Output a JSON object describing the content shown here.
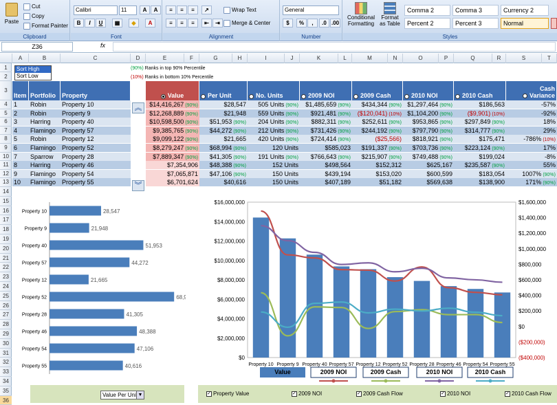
{
  "ribbon": {
    "clipboard": {
      "label": "Clipboard",
      "paste": "Paste",
      "cut": "Cut",
      "copy": "Copy",
      "format_painter": "Format Painter"
    },
    "font": {
      "label": "Font",
      "family": "Calibri",
      "size": "11"
    },
    "alignment": {
      "label": "Alignment",
      "wrap": "Wrap Text",
      "merge": "Merge & Center"
    },
    "number": {
      "label": "Number",
      "format": "General"
    },
    "styles": {
      "label": "Styles",
      "cond": "Conditional",
      "cond2": "Formatting",
      "fmt": "Format",
      "fmt2": "as Table",
      "cells": [
        "Comma 2",
        "Comma 3",
        "Currency 2",
        "Percent 2",
        "Percent 3",
        "Normal"
      ]
    }
  },
  "formula_bar": {
    "cell_ref": "Z36",
    "fx": "fx"
  },
  "columns": [
    "A",
    "B",
    "C",
    "D",
    "E",
    "F",
    "G",
    "H",
    "I",
    "J",
    "K",
    "L",
    "M",
    "N",
    "O",
    "P",
    "Q",
    "R",
    "S",
    "T"
  ],
  "rows": [
    "1",
    "2",
    "3",
    "4",
    "5",
    "6",
    "7",
    "8",
    "9",
    "10",
    "11",
    "12",
    "13",
    "14",
    "15",
    "16",
    "17",
    "18",
    "19",
    "20",
    "21",
    "22",
    "23",
    "24",
    "25",
    "26",
    "27",
    "28",
    "29",
    "30",
    "31",
    "32",
    "33",
    "34",
    "35",
    "36"
  ],
  "sort": {
    "high": "Sort High",
    "low": "Sort Low"
  },
  "legend_notes": {
    "top_tag": "(90%)",
    "top_text": "Ranks in top 90% Percentile",
    "bot_tag": "(10%)",
    "bot_text": "Ranks in bottom 10% Percentile"
  },
  "table": {
    "headers": {
      "item": "Item",
      "portfolio": "Portfolio",
      "property": "Property",
      "value": "Value",
      "per_unit": "Per Unit",
      "units": "No. Units",
      "noi09": "2009 NOI",
      "cash09": "2009 Cash",
      "noi10": "2010 NOI",
      "cash10": "2010 Cash",
      "cashvar1": "Cash",
      "cashvar2": "Variance"
    },
    "rows": [
      {
        "item": "1",
        "portfolio": "Robin",
        "property": "Property 10",
        "value": "$14,416,267",
        "vt": "(90%)",
        "pu": "$28,547",
        "put": "",
        "units": "505 Units",
        "ut": "(90%)",
        "noi09": "$1,485,659",
        "n9t": "(90%)",
        "cash09": "$434,344",
        "c9t": "(90%)",
        "noi10": "$1,297,464",
        "n10t": "(90%)",
        "cash10": "$186,563",
        "c10t": "",
        "cv": "-57%",
        "cvt": ""
      },
      {
        "item": "2",
        "portfolio": "Robin",
        "property": "Property 9",
        "value": "$12,268,889",
        "vt": "(90%)",
        "pu": "$21,948",
        "put": "",
        "units": "559 Units",
        "ut": "(90%)",
        "noi09": "$921,481",
        "n9t": "(90%)",
        "cash09": "($120,041)",
        "c9t": "(10%)",
        "noi10": "$1,104,200",
        "n10t": "(90%)",
        "cash10": "($9,901)",
        "c10t": "(10%)",
        "cv": "-92%",
        "cvt": ""
      },
      {
        "item": "3",
        "portfolio": "Harring",
        "property": "Property 40",
        "value": "$10,598,500",
        "vt": "(90%)",
        "pu": "$51,953",
        "put": "(90%)",
        "units": "204 Units",
        "ut": "(90%)",
        "noi09": "$882,311",
        "n9t": "(90%)",
        "cash09": "$252,611",
        "c9t": "(90%)",
        "noi10": "$953,865",
        "n10t": "(90%)",
        "cash10": "$297,849",
        "c10t": "(90%)",
        "cv": "18%",
        "cvt": ""
      },
      {
        "item": "4",
        "portfolio": "Flamingo",
        "property": "Property 57",
        "value": "$9,385,765",
        "vt": "(90%)",
        "pu": "$44,272",
        "put": "(90%)",
        "units": "212 Units",
        "ut": "(90%)",
        "noi09": "$731,426",
        "n9t": "(90%)",
        "cash09": "$244,192",
        "c9t": "(90%)",
        "noi10": "$797,790",
        "n10t": "(90%)",
        "cash10": "$314,777",
        "c10t": "(90%)",
        "cv": "29%",
        "cvt": ""
      },
      {
        "item": "5",
        "portfolio": "Robin",
        "property": "Property 12",
        "value": "$9,099,122",
        "vt": "(90%)",
        "pu": "$21,665",
        "put": "",
        "units": "420 Units",
        "ut": "(90%)",
        "noi09": "$724,414",
        "n9t": "(90%)",
        "cash09": "($25,566)",
        "c9t": "",
        "noi10": "$818,921",
        "n10t": "(90%)",
        "cash10": "$175,471",
        "c10t": "",
        "cv": "-786%",
        "cvt": "(10%)"
      },
      {
        "item": "6",
        "portfolio": "Flamingo",
        "property": "Property 52",
        "value": "$8,279,247",
        "vt": "(90%)",
        "pu": "$68,994",
        "put": "(90%)",
        "units": "120 Units",
        "ut": "",
        "noi09": "$585,023",
        "n9t": "",
        "cash09": "$191,337",
        "c9t": "(90%)",
        "noi10": "$703,736",
        "n10t": "(90%)",
        "cash10": "$223,124",
        "c10t": "(90%)",
        "cv": "17%",
        "cvt": ""
      },
      {
        "item": "7",
        "portfolio": "Sparrow",
        "property": "Property 28",
        "value": "$7,889,347",
        "vt": "(90%)",
        "pu": "$41,305",
        "put": "(90%)",
        "units": "191 Units",
        "ut": "(90%)",
        "noi09": "$766,643",
        "n9t": "(90%)",
        "cash09": "$215,907",
        "c9t": "(90%)",
        "noi10": "$749,488",
        "n10t": "(90%)",
        "cash10": "$199,024",
        "c10t": "",
        "cv": "-8%",
        "cvt": ""
      },
      {
        "item": "8",
        "portfolio": "Harring",
        "property": "Property 46",
        "value": "$7,354,906",
        "vt": "",
        "pu": "$48,388",
        "put": "(90%)",
        "units": "152 Units",
        "ut": "",
        "noi09": "$498,564",
        "n9t": "",
        "cash09": "$152,312",
        "c9t": "",
        "noi10": "$625,167",
        "n10t": "",
        "cash10": "$235,587",
        "c10t": "(90%)",
        "cv": "55%",
        "cvt": ""
      },
      {
        "item": "9",
        "portfolio": "Flamingo",
        "property": "Property 54",
        "value": "$7,065,871",
        "vt": "",
        "pu": "$47,106",
        "put": "(90%)",
        "units": "150 Units",
        "ut": "",
        "noi09": "$439,194",
        "n9t": "",
        "cash09": "$153,020",
        "c9t": "",
        "noi10": "$600,599",
        "n10t": "",
        "cash10": "$183,054",
        "c10t": "",
        "cv": "1007%",
        "cvt": "(90%)"
      },
      {
        "item": "10",
        "portfolio": "Flamingo",
        "property": "Property 55",
        "value": "$6,701,624",
        "vt": "",
        "pu": "$40,616",
        "put": "",
        "units": "150 Units",
        "ut": "",
        "noi09": "$407,189",
        "n9t": "",
        "cash09": "$51,182",
        "c9t": "",
        "noi10": "$569,638",
        "n10t": "",
        "cash10": "$138,900",
        "c10t": "",
        "cv": "171%",
        "cvt": "(90%)"
      }
    ]
  },
  "chart_data": [
    {
      "type": "bar",
      "orientation": "horizontal",
      "categories": [
        "Property 10",
        "Property 9",
        "Property 40",
        "Property 57",
        "Property 12",
        "Property 52",
        "Property 28",
        "Property 46",
        "Property 54",
        "Property 55"
      ],
      "values": [
        28547,
        21948,
        51953,
        44272,
        21665,
        68994,
        41305,
        48388,
        47106,
        40616
      ],
      "labels": [
        "28,547",
        "21,948",
        "51,953",
        "44,272",
        "21,665",
        "68,994",
        "41,305",
        "48,388",
        "47,106",
        "40,616"
      ],
      "xlim": [
        0,
        80000
      ],
      "color": "#4a7ebb"
    },
    {
      "type": "bar",
      "categories": [
        "Property 10",
        "Property 9",
        "Property 40",
        "Property 57",
        "Property 12",
        "Property 52",
        "Property 28",
        "Property 46",
        "Property 54",
        "Property 55"
      ],
      "ylim": [
        0,
        16000000
      ],
      "y2lim": [
        -400000,
        1600000
      ],
      "yticks": [
        "$0",
        "$2,000,000",
        "$4,000,000",
        "$6,000,000",
        "$8,000,000",
        "$10,000,000",
        "$12,000,000",
        "$14,000,000",
        "$16,000,000"
      ],
      "y2ticks": [
        "($400,000)",
        "($200,000)",
        "$0",
        "$200,000",
        "$400,000",
        "$600,000",
        "$800,000",
        "$1,000,000",
        "$1,200,000",
        "$1,400,000",
        "$1,600,000"
      ],
      "series": [
        {
          "name": "Value",
          "type": "bar",
          "axis": "left",
          "color": "#4a7ebb",
          "values": [
            14416267,
            12268889,
            10598500,
            9385765,
            9099122,
            8279247,
            7889347,
            7354906,
            7065871,
            6701624
          ]
        },
        {
          "name": "2009 NOI",
          "type": "line",
          "axis": "right",
          "color": "#c0504d",
          "values": [
            1485659,
            921481,
            882311,
            731426,
            724414,
            585023,
            766643,
            498564,
            439194,
            407189
          ]
        },
        {
          "name": "2009 Cash",
          "type": "line",
          "axis": "right",
          "color": "#9bbb59",
          "values": [
            434344,
            -120041,
            252611,
            244192,
            -25566,
            191337,
            215907,
            152312,
            153020,
            51182
          ]
        },
        {
          "name": "2010 NOI",
          "type": "line",
          "axis": "right",
          "color": "#8064a2",
          "values": [
            1297464,
            1104200,
            953865,
            797790,
            818921,
            703736,
            749488,
            625167,
            600599,
            569638
          ]
        },
        {
          "name": "2010 Cash",
          "type": "line",
          "axis": "right",
          "color": "#4bacc6",
          "values": [
            186563,
            -9901,
            297849,
            314777,
            175471,
            223124,
            199024,
            235587,
            183054,
            138900
          ]
        }
      ]
    }
  ],
  "controls": {
    "dropdown": "Value Per Unit",
    "checks": [
      "Property Value",
      "2009 NOI",
      "2009 Cash Flow",
      "2010 NOI",
      "2010 Cash Flow"
    ]
  }
}
